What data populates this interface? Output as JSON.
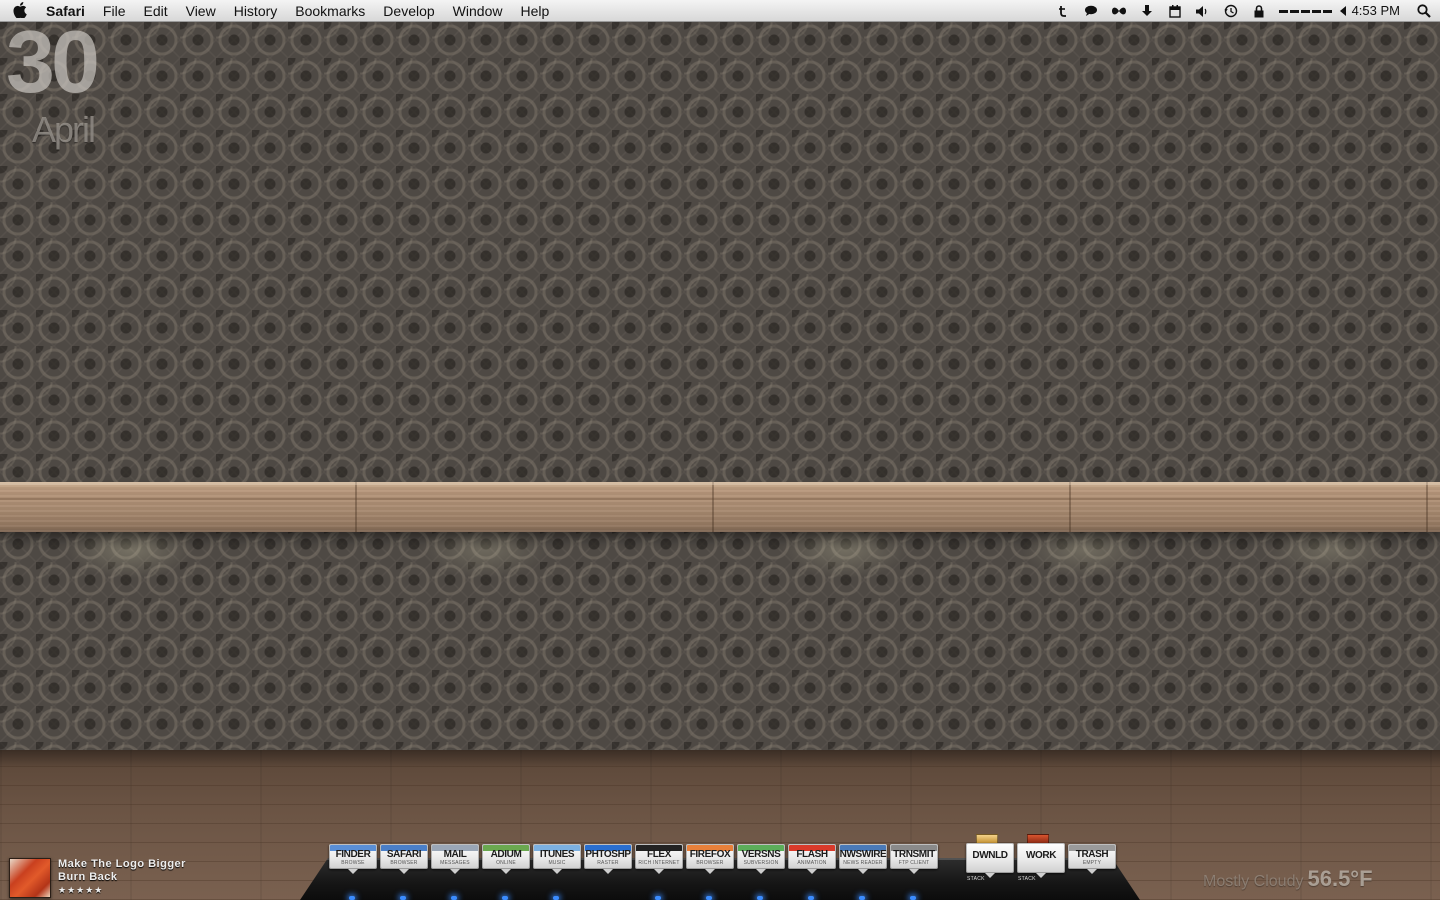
{
  "menubar": {
    "app_name": "Safari",
    "menus": [
      "File",
      "Edit",
      "View",
      "History",
      "Bookmarks",
      "Develop",
      "Window",
      "Help"
    ],
    "status_icons": [
      "text-icon",
      "chat-icon",
      "butterfly-icon",
      "download-icon",
      "calendar-icon",
      "volume-icon",
      "time-machine-icon",
      "lock-icon"
    ],
    "clock": "4:53 PM"
  },
  "date_widget": {
    "day": "30",
    "month": "April"
  },
  "now_playing": {
    "title": "Make The Logo Bigger",
    "artist": "Burn Back",
    "rating": "★★★★★"
  },
  "weather": {
    "condition": "Mostly Cloudy",
    "temperature": "56.5°F"
  },
  "dock": {
    "apps": [
      {
        "name": "FINDER",
        "sub": "BROWSE",
        "color": "#5a8fd6",
        "running": true
      },
      {
        "name": "SAFARI",
        "sub": "BROWSER",
        "color": "#4a7fc8",
        "running": true
      },
      {
        "name": "MAIL",
        "sub": "MESSAGES",
        "color": "#9aa6b6",
        "running": true
      },
      {
        "name": "ADIUM",
        "sub": "ONLINE",
        "color": "#6aa84f",
        "running": true
      },
      {
        "name": "ITUNES",
        "sub": "MUSIC",
        "color": "#7cb0e0",
        "running": true
      },
      {
        "name": "PHTOSHP",
        "sub": "RASTER",
        "color": "#2a6fd0",
        "running": false
      },
      {
        "name": "FLEX",
        "sub": "RICH INTERNET",
        "color": "#222222",
        "running": true
      },
      {
        "name": "FIREFOX",
        "sub": "BROWSER",
        "color": "#e8803a",
        "running": true
      },
      {
        "name": "VERSNS",
        "sub": "SUBVERSION",
        "color": "#5cae5a",
        "running": true
      },
      {
        "name": "FLASH",
        "sub": "ANIMATION",
        "color": "#d93a2a",
        "running": true
      },
      {
        "name": "NWSWIRE",
        "sub": "NEWS READER",
        "color": "#4a7ab8",
        "running": true
      },
      {
        "name": "TRNSMIT",
        "sub": "FTP CLIENT",
        "color": "#8a8a8a",
        "running": true
      }
    ],
    "stacks": [
      {
        "name": "DWNLD",
        "label": "STACK"
      },
      {
        "name": "WORK",
        "label": "STACK"
      }
    ],
    "trash": {
      "name": "TRASH",
      "sub": "EMPTY"
    }
  }
}
